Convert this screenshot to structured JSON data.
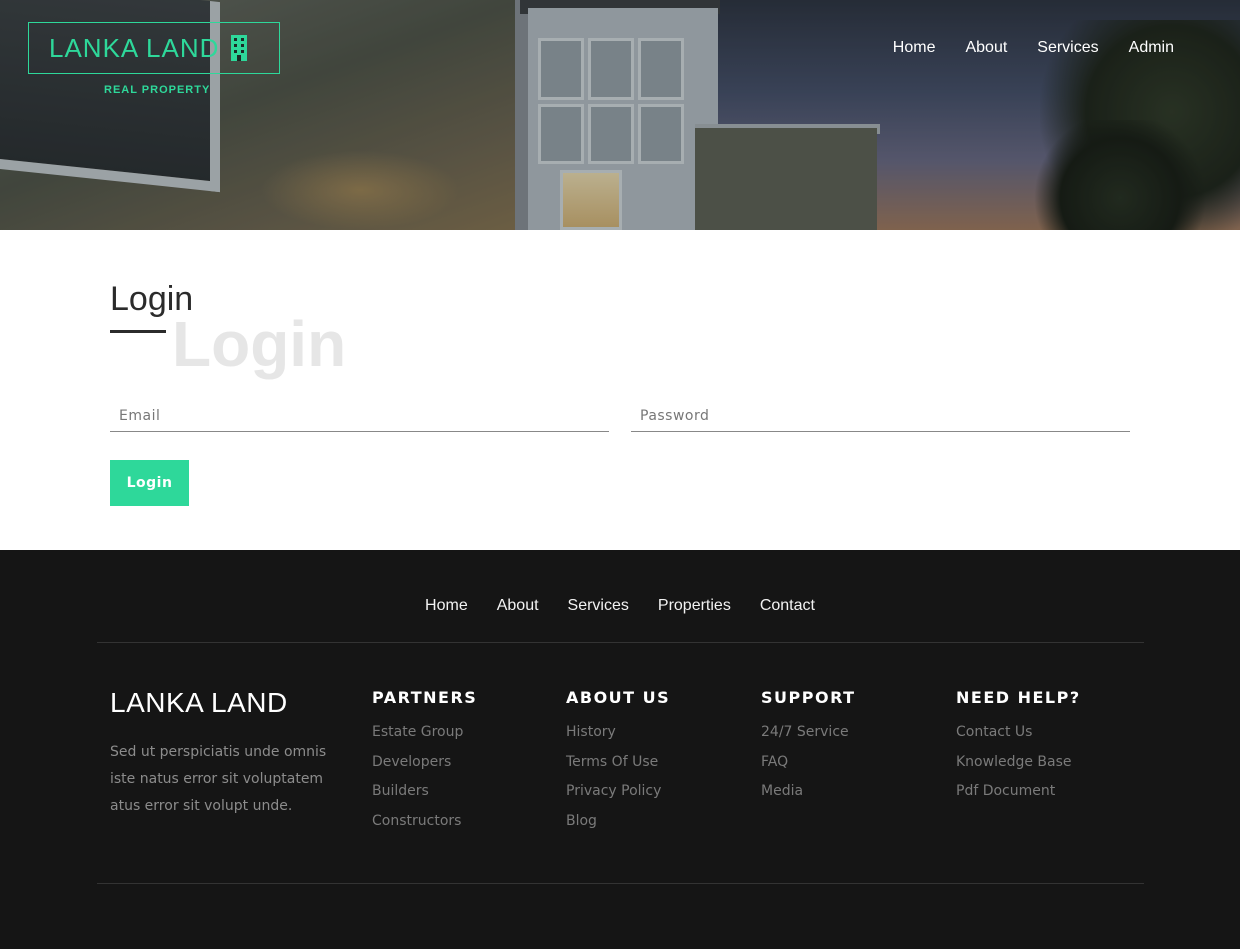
{
  "header": {
    "logo_text": "LANKA LAND",
    "logo_subtitle": "REAL PROPERTY",
    "nav": [
      "Home",
      "About",
      "Services",
      "Admin"
    ]
  },
  "login": {
    "title": "Login",
    "ghost_title": "Login",
    "email_placeholder": "Email",
    "password_placeholder": "Password",
    "button_label": "Login"
  },
  "footer": {
    "nav": [
      "Home",
      "About",
      "Services",
      "Properties",
      "Contact"
    ],
    "brand": {
      "name": "LANKA LAND",
      "description": "Sed ut perspiciatis unde omnis iste natus error sit voluptatem atus error sit volupt unde."
    },
    "columns": [
      {
        "title": "PARTNERS",
        "links": [
          "Estate Group",
          "Developers",
          "Builders",
          "Constructors"
        ]
      },
      {
        "title": "ABOUT US",
        "links": [
          "History",
          "Terms Of Use",
          "Privacy Policy",
          "Blog"
        ]
      },
      {
        "title": "SUPPORT",
        "links": [
          "24/7 Service",
          "FAQ",
          "Media"
        ]
      },
      {
        "title": "NEED HELP?",
        "links": [
          "Contact Us",
          "Knowledge Base",
          "Pdf Document"
        ]
      }
    ]
  },
  "colors": {
    "accent": "#2ed89a",
    "footer_bg": "#151515",
    "ghost_text": "#e6e6e6"
  },
  "icons": {
    "logo_icon": "building-icon"
  }
}
